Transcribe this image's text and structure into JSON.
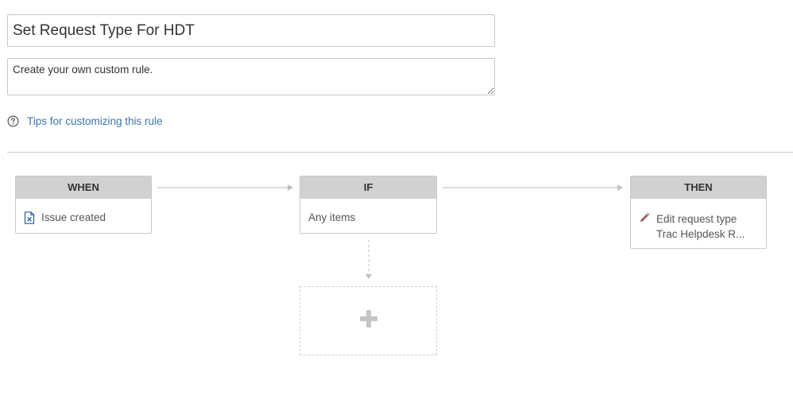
{
  "rule": {
    "name": "Set Request Type For HDT",
    "description": "Create your own custom rule."
  },
  "tips": {
    "icon": "help-circle-icon",
    "label": "Tips for customizing this rule"
  },
  "flow": {
    "when": {
      "header": "WHEN",
      "icon": "issue-created-icon",
      "label": "Issue created"
    },
    "if": {
      "header": "IF",
      "label": "Any items"
    },
    "then": {
      "header": "THEN",
      "icon": "pencil-icon",
      "line1": "Edit request type",
      "line2": "Trac Helpdesk R..."
    },
    "add": {
      "icon": "plus-icon"
    }
  },
  "colors": {
    "link": "#3b73af",
    "header_bg": "#d1d1d1",
    "border": "#c9c9c9",
    "pencil": "#a05a5a",
    "issue_icon": "#2a5e9f"
  }
}
